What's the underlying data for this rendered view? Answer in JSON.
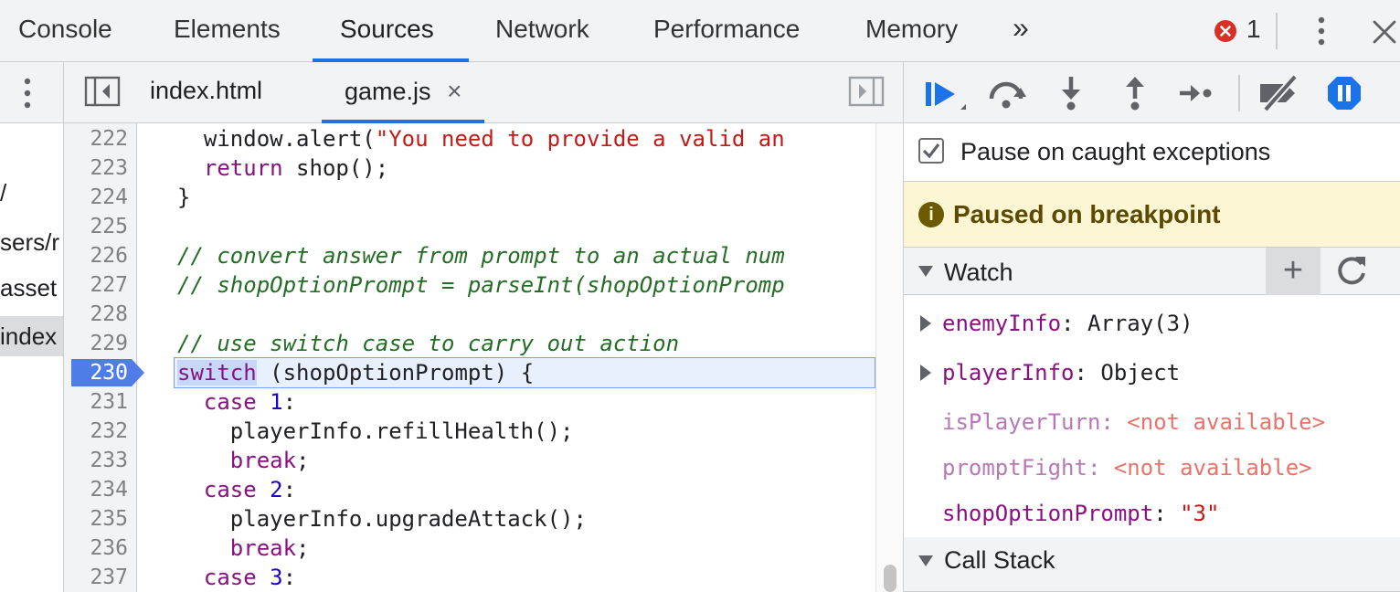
{
  "top_tabs": [
    {
      "label": "Console"
    },
    {
      "label": "Elements"
    },
    {
      "label": "Sources",
      "active": true
    },
    {
      "label": "Network"
    },
    {
      "label": "Performance"
    },
    {
      "label": "Memory"
    }
  ],
  "top_more": "»",
  "error_count": "1",
  "file_tree": [
    "/",
    "sers/r",
    "asset",
    "index"
  ],
  "editor_tabs": [
    {
      "label": "index.html"
    },
    {
      "label": "game.js",
      "active": true,
      "close": "×"
    }
  ],
  "code_lines": [
    {
      "num": "222",
      "segments": [
        {
          "t": "  window.alert(",
          "c": ""
        },
        {
          "t": "\"You need to provide a valid an",
          "c": "str"
        }
      ]
    },
    {
      "num": "223",
      "segments": [
        {
          "t": "  ",
          "c": ""
        },
        {
          "t": "return",
          "c": "kw"
        },
        {
          "t": " shop();",
          "c": ""
        }
      ]
    },
    {
      "num": "224",
      "segments": [
        {
          "t": "}",
          "c": ""
        }
      ]
    },
    {
      "num": "225",
      "segments": []
    },
    {
      "num": "226",
      "segments": [
        {
          "t": "// convert answer from prompt to an actual num",
          "c": "com"
        }
      ]
    },
    {
      "num": "227",
      "segments": [
        {
          "t": "// shopOptionPrompt = parseInt(shopOptionPromp",
          "c": "com"
        }
      ]
    },
    {
      "num": "228",
      "segments": []
    },
    {
      "num": "229",
      "segments": [
        {
          "t": "// use switch case to carry out action",
          "c": "com"
        }
      ]
    },
    {
      "num": "230",
      "segments": [
        {
          "t": "switch",
          "c": "kw hl-word"
        },
        {
          "t": " (shopOptionPrompt) {",
          "c": ""
        }
      ]
    },
    {
      "num": "231",
      "segments": [
        {
          "t": "  ",
          "c": ""
        },
        {
          "t": "case",
          "c": "kw"
        },
        {
          "t": " ",
          "c": ""
        },
        {
          "t": "1",
          "c": "num"
        },
        {
          "t": ":",
          "c": ""
        }
      ]
    },
    {
      "num": "232",
      "segments": [
        {
          "t": "    playerInfo.refillHealth();",
          "c": ""
        }
      ]
    },
    {
      "num": "233",
      "segments": [
        {
          "t": "    ",
          "c": ""
        },
        {
          "t": "break",
          "c": "kw"
        },
        {
          "t": ";",
          "c": ""
        }
      ]
    },
    {
      "num": "234",
      "segments": [
        {
          "t": "  ",
          "c": ""
        },
        {
          "t": "case",
          "c": "kw"
        },
        {
          "t": " ",
          "c": ""
        },
        {
          "t": "2",
          "c": "num"
        },
        {
          "t": ":",
          "c": ""
        }
      ]
    },
    {
      "num": "235",
      "segments": [
        {
          "t": "    playerInfo.upgradeAttack();",
          "c": ""
        }
      ]
    },
    {
      "num": "236",
      "segments": [
        {
          "t": "    ",
          "c": ""
        },
        {
          "t": "break",
          "c": "kw"
        },
        {
          "t": ";",
          "c": ""
        }
      ]
    },
    {
      "num": "237",
      "segments": [
        {
          "t": "  ",
          "c": ""
        },
        {
          "t": "case",
          "c": "kw"
        },
        {
          "t": " ",
          "c": ""
        },
        {
          "t": "3",
          "c": "num"
        },
        {
          "t": ":",
          "c": ""
        }
      ]
    }
  ],
  "current_line": "230",
  "debugger": {
    "pause_on_caught_label": "Pause on caught exceptions",
    "pause_on_caught_checked": true,
    "status": "Paused on breakpoint",
    "status_icon": "i",
    "watch_title": "Watch",
    "watch_add": "+",
    "watch": [
      {
        "name": "enemyInfo",
        "value": "Array(3)",
        "expandable": true
      },
      {
        "name": "playerInfo",
        "value": "Object",
        "expandable": true
      },
      {
        "name": "isPlayerTurn",
        "value": "<not available>",
        "na": true
      },
      {
        "name": "promptFight",
        "value": "<not available>",
        "na": true
      },
      {
        "name": "shopOptionPrompt",
        "value": "\"3\"",
        "string": true
      }
    ],
    "callstack_title": "Call Stack"
  },
  "colors": {
    "accent": "#1a73e8",
    "keyword": "#881280",
    "string": "#c41a16",
    "comment": "#236e25",
    "paused_bg": "#fdf6d5",
    "error": "#d93025"
  },
  "icons": {
    "toggle_navigator": "sidebar-toggle-icon",
    "toggle_debugger": "sidebar-right-toggle-icon",
    "resume": "resume-icon",
    "step_over": "step-over-icon",
    "step_into": "step-into-icon",
    "step_out": "step-out-icon",
    "step": "step-icon",
    "deactivate": "deactivate-breakpoints-icon",
    "pause_exceptions": "pause-on-exceptions-icon",
    "refresh": "refresh-icon"
  }
}
